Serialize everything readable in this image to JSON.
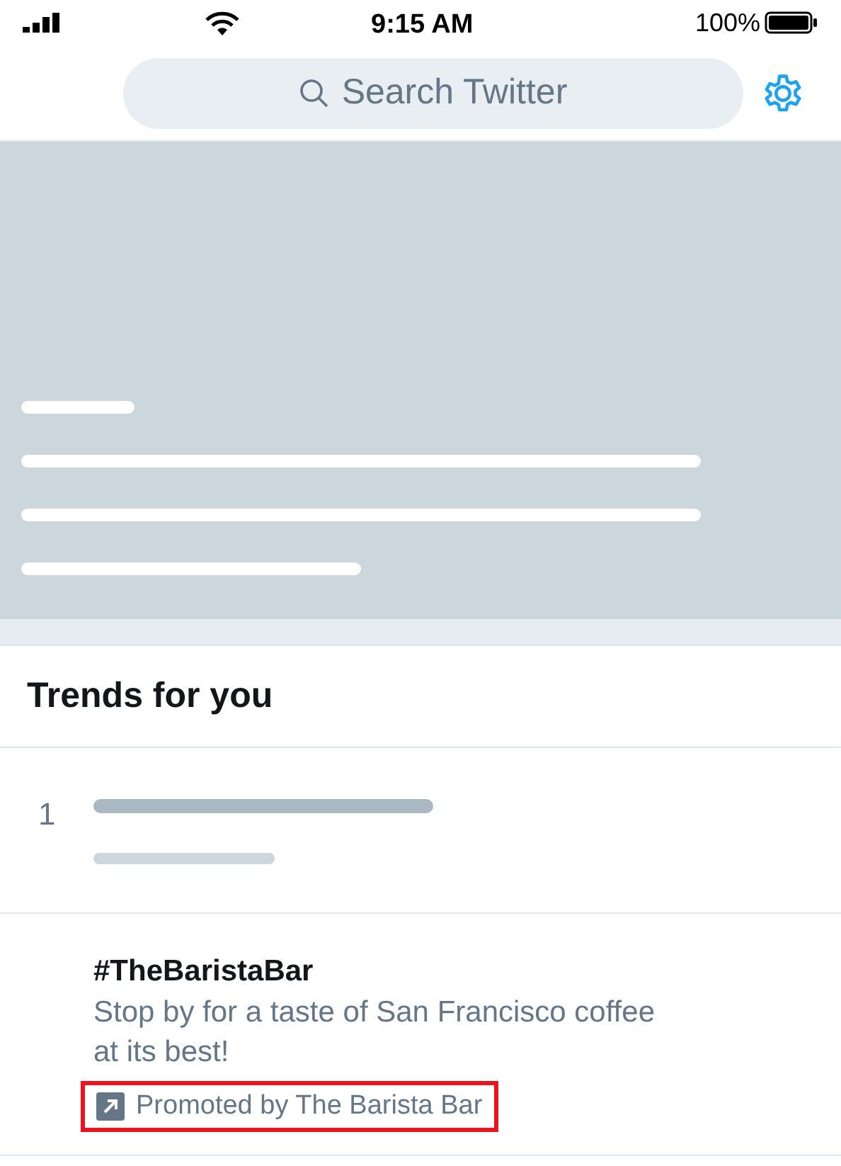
{
  "status_bar": {
    "time": "9:15 AM",
    "battery": "100%"
  },
  "search": {
    "placeholder": "Search Twitter"
  },
  "banner": {
    "kind": "placeholder"
  },
  "trends": {
    "title": "Trends for you",
    "items": [
      {
        "kind": "placeholder",
        "rank": "1"
      },
      {
        "kind": "promoted",
        "hashtag": "#TheBaristaBar",
        "description": "Stop by for a taste of San Francisco coffee at its best!",
        "promoted_by": "Promoted by The Barista Bar",
        "highlighted": true
      }
    ]
  }
}
